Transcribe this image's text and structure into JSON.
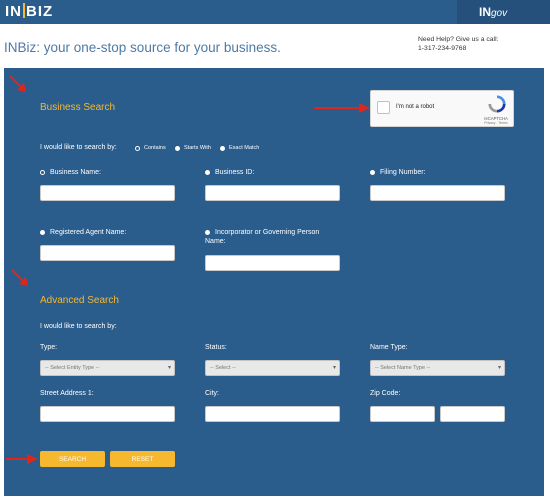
{
  "header": {
    "logo_left": "IN",
    "logo_right": "BIZ",
    "ingov_left": "IN",
    "ingov_right": "gov"
  },
  "tagline": "INBiz: your one-stop source for your business.",
  "help": {
    "line1": "Need Help? Give us a call:",
    "phone": "1-317-234-9768"
  },
  "business_search": {
    "title": "Business Search",
    "search_by_label": "I would like to search by:",
    "options": [
      "Contains",
      "Starts With",
      "Exact Match"
    ],
    "selected_option": "Contains",
    "fields": {
      "business_name": "Business Name:",
      "business_id": "Business ID:",
      "filing_number": "Filing Number:",
      "registered_agent": "Registered Agent Name:",
      "incorporator_line1": "Incorporator or Governing Person",
      "incorporator_line2": "Name:"
    }
  },
  "captcha": {
    "label": "I'm not a robot",
    "brand": "reCAPTCHA",
    "links": "Privacy - Terms"
  },
  "advanced_search": {
    "title": "Advanced Search",
    "search_by_label": "I would like to search by:",
    "type_label": "Type:",
    "type_placeholder": "-- Select Entity Type --",
    "status_label": "Status:",
    "status_placeholder": "-- Select --",
    "name_type_label": "Name Type:",
    "name_type_placeholder": "-- Select Name Type --",
    "street_label": "Street Address 1:",
    "city_label": "City:",
    "zip_label": "Zip Code:"
  },
  "buttons": {
    "search": "SEARCH",
    "reset": "RESET"
  },
  "colors": {
    "panel": "#2a5d8c",
    "accent": "#f5b82e",
    "arrow": "#e0261b"
  }
}
